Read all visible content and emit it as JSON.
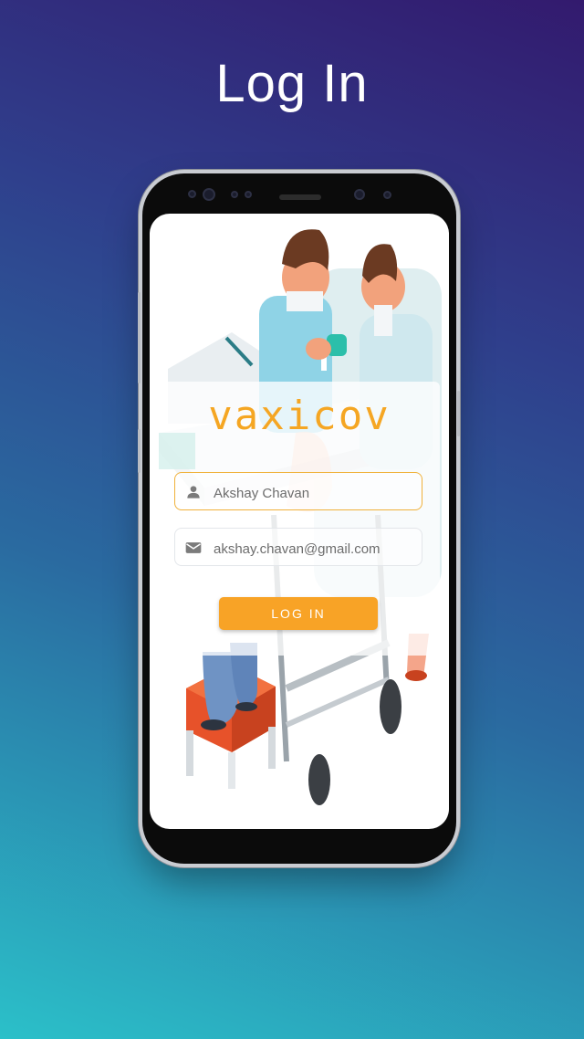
{
  "page": {
    "title": "Log In"
  },
  "app": {
    "logo_text": "vaxicov"
  },
  "form": {
    "name_field": {
      "value": "Akshay Chavan",
      "icon": "person-icon"
    },
    "email_field": {
      "value": "akshay.chavan@gmail.com",
      "icon": "mail-icon"
    },
    "login_label": "LOG IN"
  },
  "colors": {
    "accent": "#f8a326",
    "logo": "#f5a623",
    "gradient_top": "#331a6e",
    "gradient_bottom": "#2bc0c9"
  }
}
